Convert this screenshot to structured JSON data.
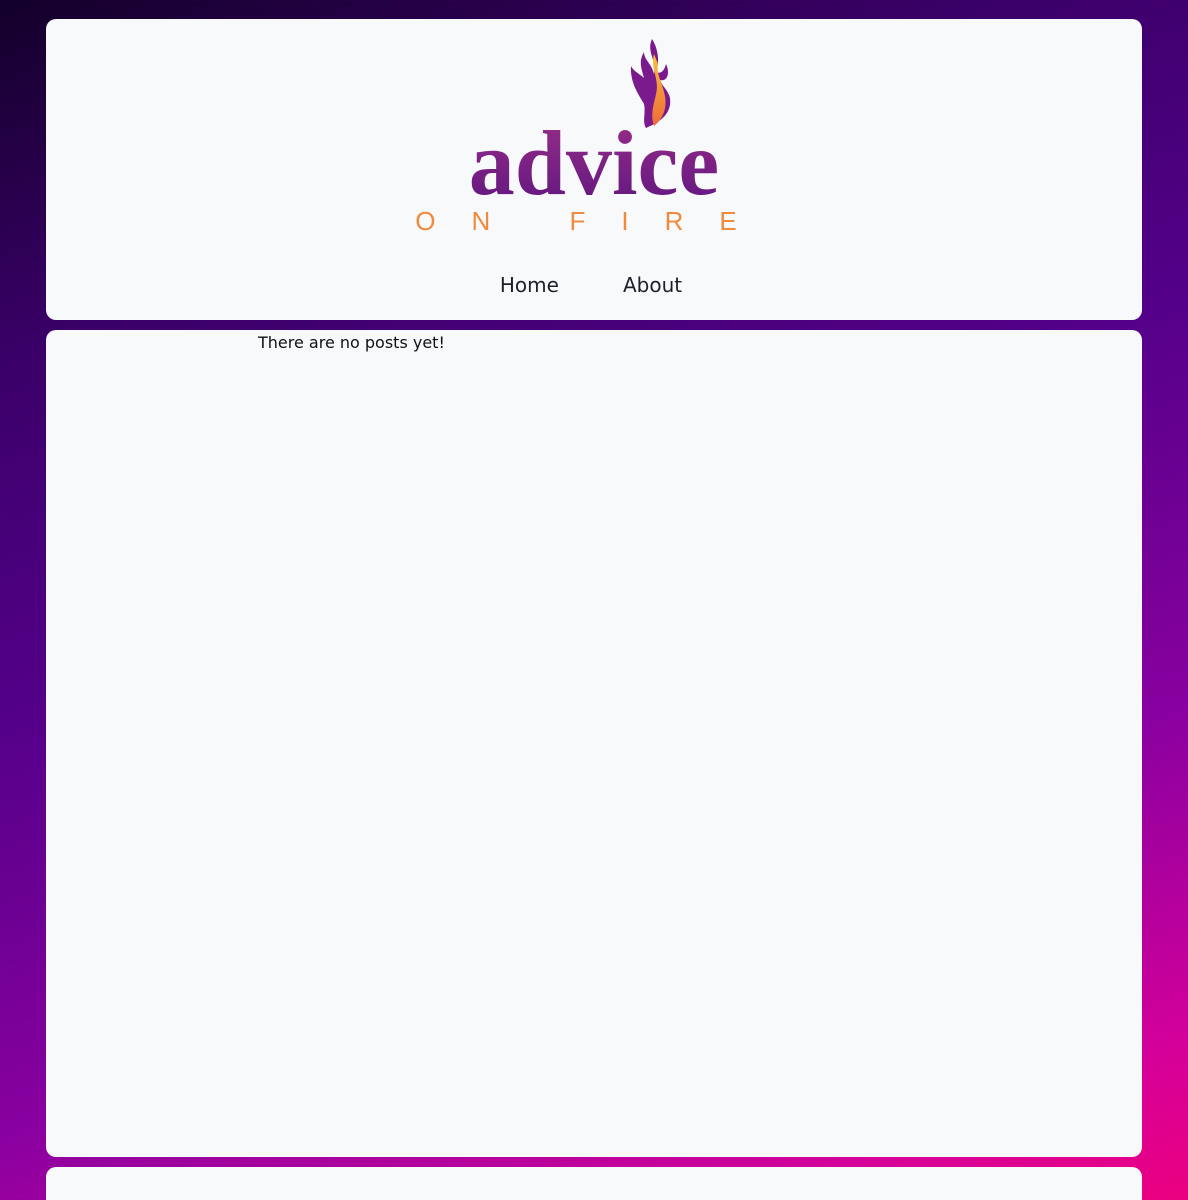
{
  "header": {
    "logo": {
      "wordmark": "advice",
      "tagline": "ON FIRE",
      "icon": "flame-icon",
      "colors": {
        "purple": "#7a1a8c",
        "orange": "#f08a3c",
        "flame_yellow": "#f6b63a"
      }
    },
    "nav": {
      "home_label": "Home",
      "about_label": "About"
    }
  },
  "main": {
    "empty_message": "There are no posts yet!"
  },
  "colors": {
    "card_background": "#f8f9fb",
    "page_gradient": [
      "#13002a",
      "#55008a",
      "#ec0080"
    ]
  }
}
